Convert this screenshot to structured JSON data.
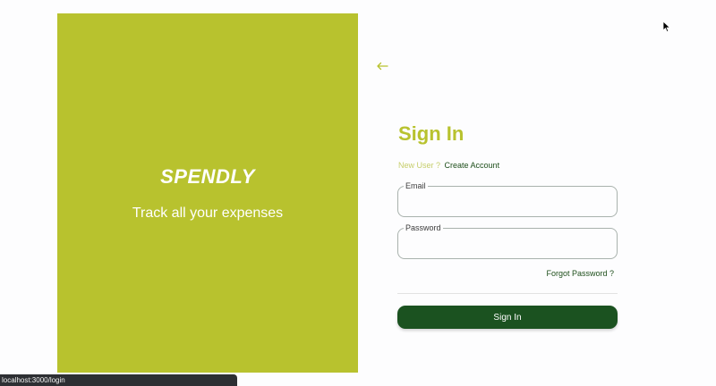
{
  "brand": {
    "name": "SPENDLY",
    "tagline": "Track all your expenses",
    "color": "#b8c22e"
  },
  "nav": {
    "back_icon": "arrow-left-icon"
  },
  "form": {
    "heading": "Sign In",
    "new_user_label": "New User ?",
    "create_account_label": "Create Account",
    "email": {
      "label": "Email",
      "value": ""
    },
    "password": {
      "label": "Password",
      "value": ""
    },
    "forgot_password_label": "Forgot Password ?",
    "submit_label": "Sign In",
    "accent_color": "#1b5220"
  },
  "status_bar": {
    "url": "localhost:3000/login"
  },
  "cursor": {
    "icon": "mouse-pointer-icon"
  }
}
